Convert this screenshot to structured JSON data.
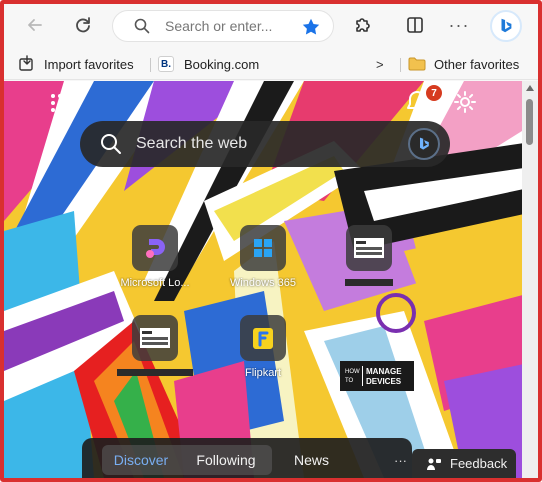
{
  "toolbar": {
    "search_placeholder": "Search or enter...",
    "more_label": "···"
  },
  "favorites": {
    "import": "Import favorites",
    "booking_badge": "B.",
    "booking": "Booking.com",
    "chevron": ">",
    "other": "Other favorites"
  },
  "newtab": {
    "notification_count": "7",
    "web_search_placeholder": "Search the web",
    "tiles": [
      {
        "label": "Microsoft Lo..."
      },
      {
        "label": "Windows 365"
      },
      {
        "label": ""
      },
      {
        "label": ""
      },
      {
        "label": "Flipkart"
      }
    ],
    "hmd_logo": {
      "line1": "HOW TO",
      "line2": "MANAGE",
      "line3": "DEVICES"
    }
  },
  "bottom": {
    "tabs": [
      "Discover",
      "Following",
      "News"
    ],
    "more": "···",
    "feedback": "Feedback"
  },
  "colors": {
    "accent_blue": "#1a73e8",
    "frame_red": "#d9302f",
    "discover_active": "#79aef2",
    "badge_red": "#d63b1f"
  }
}
